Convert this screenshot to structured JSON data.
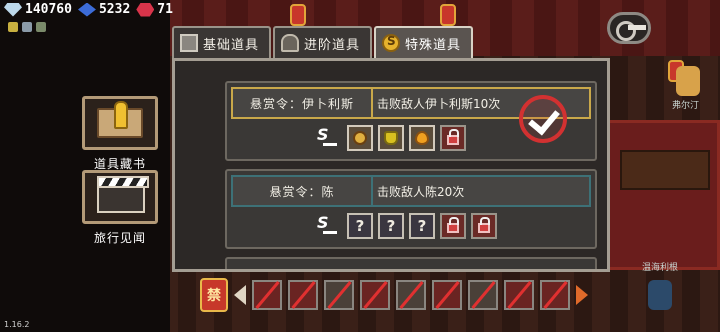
{
  "currency": {
    "diamond": "140760",
    "blue_gem": "5232",
    "red_gem": "71"
  },
  "version": "1.16.2",
  "left_menu": [
    {
      "label": "道具藏书",
      "icon": "book-key-icon"
    },
    {
      "label": "旅行见闻",
      "icon": "clapperboard-icon"
    }
  ],
  "tabs": [
    {
      "label": "基础道具",
      "icon": "basic-items-icon",
      "active": false
    },
    {
      "label": "进阶道具",
      "icon": "advanced-items-icon",
      "active": false
    },
    {
      "label": "特殊道具",
      "icon": "special-items-icon",
      "active": true
    }
  ],
  "bounties": [
    {
      "name": "悬赏令：伊卜利斯",
      "description": "击败敌人伊卜利斯10次",
      "completed": true,
      "rewards": [
        {
          "state": "unlocked",
          "icon": "bomb-item-icon"
        },
        {
          "state": "unlocked",
          "icon": "glove-item-icon"
        },
        {
          "state": "unlocked",
          "icon": "oil-drop-item-icon"
        },
        {
          "state": "locked",
          "icon": "lock-icon"
        }
      ]
    },
    {
      "name": "悬赏令：陈",
      "description": "击败敌人陈20次",
      "completed": false,
      "rewards": [
        {
          "state": "unknown",
          "text": "?"
        },
        {
          "state": "unknown",
          "text": "?"
        },
        {
          "state": "unknown",
          "text": "?"
        },
        {
          "state": "locked",
          "icon": "lock-icon"
        },
        {
          "state": "locked",
          "icon": "lock-icon"
        }
      ]
    }
  ],
  "bottom_badge": "禁",
  "npc_labels": [
    "弗尔汀",
    "温海利根"
  ],
  "colors": {
    "panel_bg": "#2c2826",
    "accent_gold": "#c9a84a",
    "accent_teal": "#3d7177",
    "stamp_red": "#d23131"
  }
}
